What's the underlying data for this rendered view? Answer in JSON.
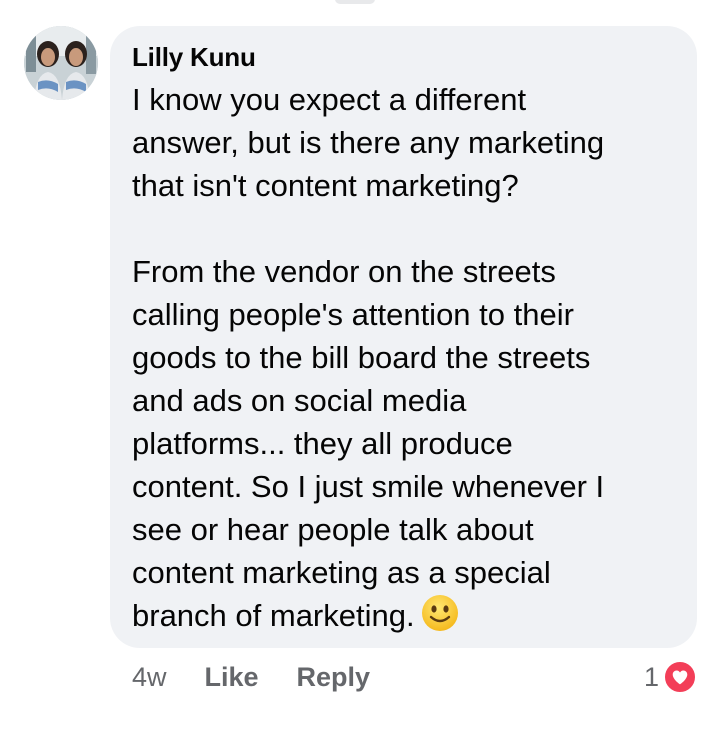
{
  "comment": {
    "author": "Lilly Kunu",
    "paragraphs": [
      {
        "lines": [
          "I know you expect a different",
          "answer, but is there any marketing",
          "that isn't content marketing?"
        ]
      },
      {
        "lines": [
          "From the vendor on the streets",
          "calling people's attention to their",
          "goods to the bill board the streets",
          "and ads on social media",
          "platforms... they all produce",
          "content. So I just smile whenever I",
          "see or hear people talk about",
          "content marketing as a special",
          "branch of marketing."
        ],
        "trailing_icon": "slightly-smiling-face-emoji"
      }
    ],
    "timestamp": "4w",
    "like_label": "Like",
    "reply_label": "Reply",
    "reaction_count": "1",
    "reaction_icon": "heart-reaction-icon"
  },
  "colors": {
    "bubble": "#f0f2f5",
    "text": "#050505",
    "meta": "#65676b",
    "heart": "#f33e58"
  }
}
